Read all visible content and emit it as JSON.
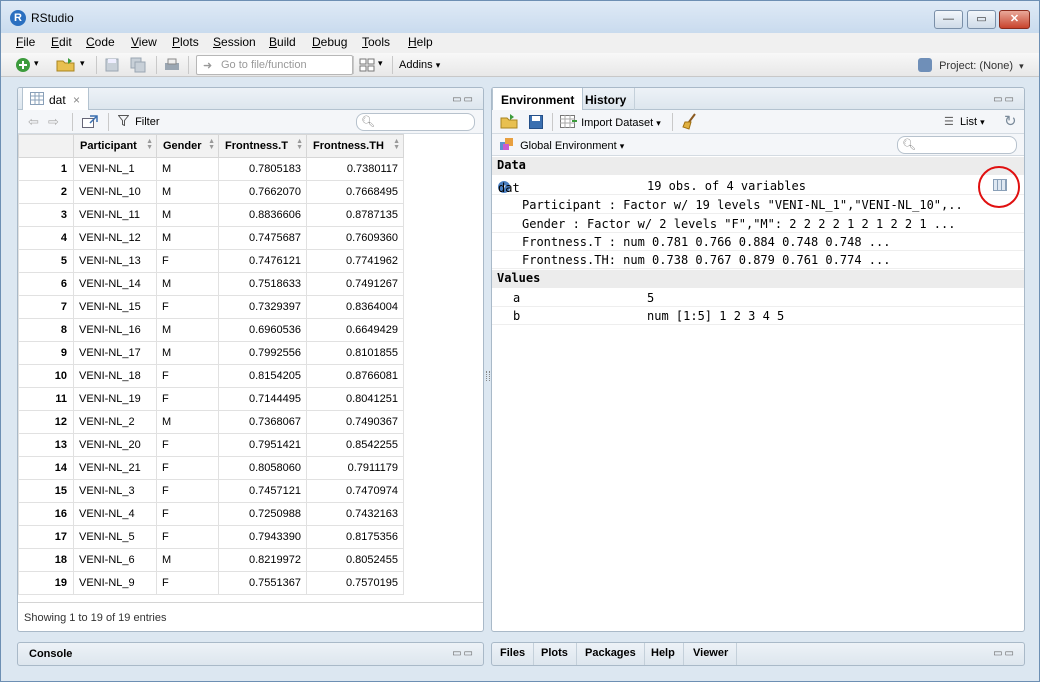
{
  "app": {
    "title": "RStudio",
    "logo": "R"
  },
  "window_buttons": {
    "minimize": "—",
    "maximize": "▭",
    "close": "✕"
  },
  "menu": [
    "File",
    "Edit",
    "Code",
    "View",
    "Plots",
    "Session",
    "Build",
    "Debug",
    "Tools",
    "Help"
  ],
  "toolbar": {
    "goto_placeholder": "Go to file/function",
    "addins_label": "Addins",
    "project_label": "Project: (None)",
    "dropdown_arrow": "▾"
  },
  "source_pane": {
    "tab_label": "dat",
    "tab_close": "×",
    "filter_label": "Filter",
    "columns": [
      "Participant",
      "Gender",
      "Frontness.T",
      "Frontness.TH"
    ],
    "rows": [
      [
        "1",
        "VENI-NL_1",
        "M",
        "0.7805183",
        "0.7380117"
      ],
      [
        "2",
        "VENI-NL_10",
        "M",
        "0.7662070",
        "0.7668495"
      ],
      [
        "3",
        "VENI-NL_11",
        "M",
        "0.8836606",
        "0.8787135"
      ],
      [
        "4",
        "VENI-NL_12",
        "M",
        "0.7475687",
        "0.7609360"
      ],
      [
        "5",
        "VENI-NL_13",
        "F",
        "0.7476121",
        "0.7741962"
      ],
      [
        "6",
        "VENI-NL_14",
        "M",
        "0.7518633",
        "0.7491267"
      ],
      [
        "7",
        "VENI-NL_15",
        "F",
        "0.7329397",
        "0.8364004"
      ],
      [
        "8",
        "VENI-NL_16",
        "M",
        "0.6960536",
        "0.6649429"
      ],
      [
        "9",
        "VENI-NL_17",
        "M",
        "0.7992556",
        "0.8101855"
      ],
      [
        "10",
        "VENI-NL_18",
        "F",
        "0.8154205",
        "0.8766081"
      ],
      [
        "11",
        "VENI-NL_19",
        "F",
        "0.7144495",
        "0.8041251"
      ],
      [
        "12",
        "VENI-NL_2",
        "M",
        "0.7368067",
        "0.7490367"
      ],
      [
        "13",
        "VENI-NL_20",
        "F",
        "0.7951421",
        "0.8542255"
      ],
      [
        "14",
        "VENI-NL_21",
        "F",
        "0.8058060",
        "0.7911179"
      ],
      [
        "15",
        "VENI-NL_3",
        "F",
        "0.7457121",
        "0.7470974"
      ],
      [
        "16",
        "VENI-NL_4",
        "F",
        "0.7250988",
        "0.7432163"
      ],
      [
        "17",
        "VENI-NL_5",
        "F",
        "0.7943390",
        "0.8175356"
      ],
      [
        "18",
        "VENI-NL_6",
        "M",
        "0.8219972",
        "0.8052455"
      ],
      [
        "19",
        "VENI-NL_9",
        "F",
        "0.7551367",
        "0.7570195"
      ]
    ],
    "showing_text": "Showing 1 to 19 of 19 entries"
  },
  "env_pane": {
    "tabs": [
      "Environment",
      "History"
    ],
    "import_label": "Import Dataset",
    "list_label": "List",
    "global_env_label": "Global Environment",
    "data_header": "Data",
    "values_header": "Values",
    "dat_name": "dat",
    "dat_desc": "19 obs. of 4 variables",
    "details": [
      "Participant : Factor w/ 19 levels \"VENI-NL_1\",\"VENI-NL_10\",..",
      "Gender : Factor w/ 2 levels \"F\",\"M\": 2 2 2 2 1 2 1 2 2 1 ...",
      "Frontness.T : num 0.781 0.766 0.884 0.748 0.748 ...",
      "Frontness.TH: num 0.738 0.767 0.879 0.761 0.774 ..."
    ],
    "values": [
      {
        "name": "a",
        "value": "5"
      },
      {
        "name": "b",
        "value": "num [1:5] 1 2 3 4 5"
      }
    ]
  },
  "console_pane": {
    "label": "Console"
  },
  "files_pane": {
    "tabs": [
      "Files",
      "Plots",
      "Packages",
      "Help",
      "Viewer"
    ]
  },
  "pane_controls": "▭▭",
  "accent_colors": {
    "highlight_ring": "#e01010",
    "window_chrome": "#dce7f1"
  }
}
